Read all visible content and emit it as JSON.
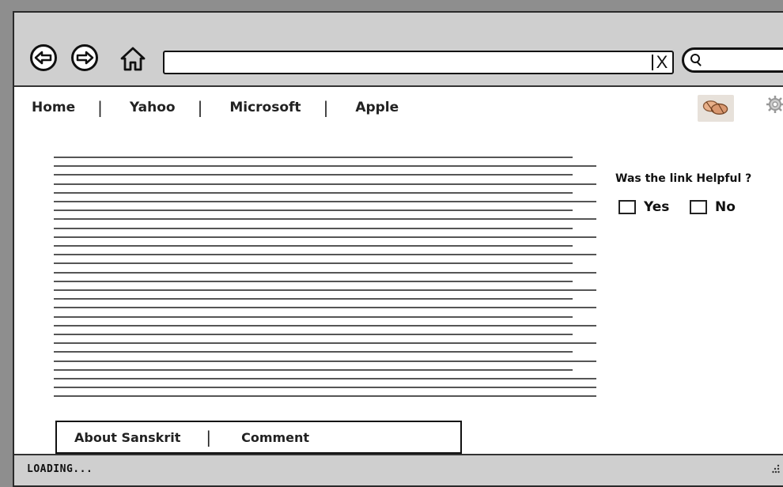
{
  "browser": {
    "url_value": "",
    "url_clear_glyph": "X",
    "search_value": ""
  },
  "nav_links": [
    {
      "label": "Home"
    },
    {
      "label": "Yahoo"
    },
    {
      "label": "Microsoft"
    },
    {
      "label": "Apple"
    }
  ],
  "nav_separator": "|",
  "content": {
    "paragraph_line_count": 28
  },
  "feedback": {
    "question": "Was the link Helpful ?",
    "options": [
      {
        "label": "Yes",
        "checked": false
      },
      {
        "label": "No",
        "checked": false
      }
    ]
  },
  "footer": {
    "links": [
      {
        "label": "About Sanskrit"
      },
      {
        "label": "Comment"
      }
    ],
    "separator": "|"
  },
  "status": {
    "text": "LOADING..."
  },
  "icons": [
    "back-icon",
    "forward-icon",
    "home-icon",
    "search-icon",
    "handshake-icon",
    "gear-icon",
    "resize-grip-icon"
  ]
}
